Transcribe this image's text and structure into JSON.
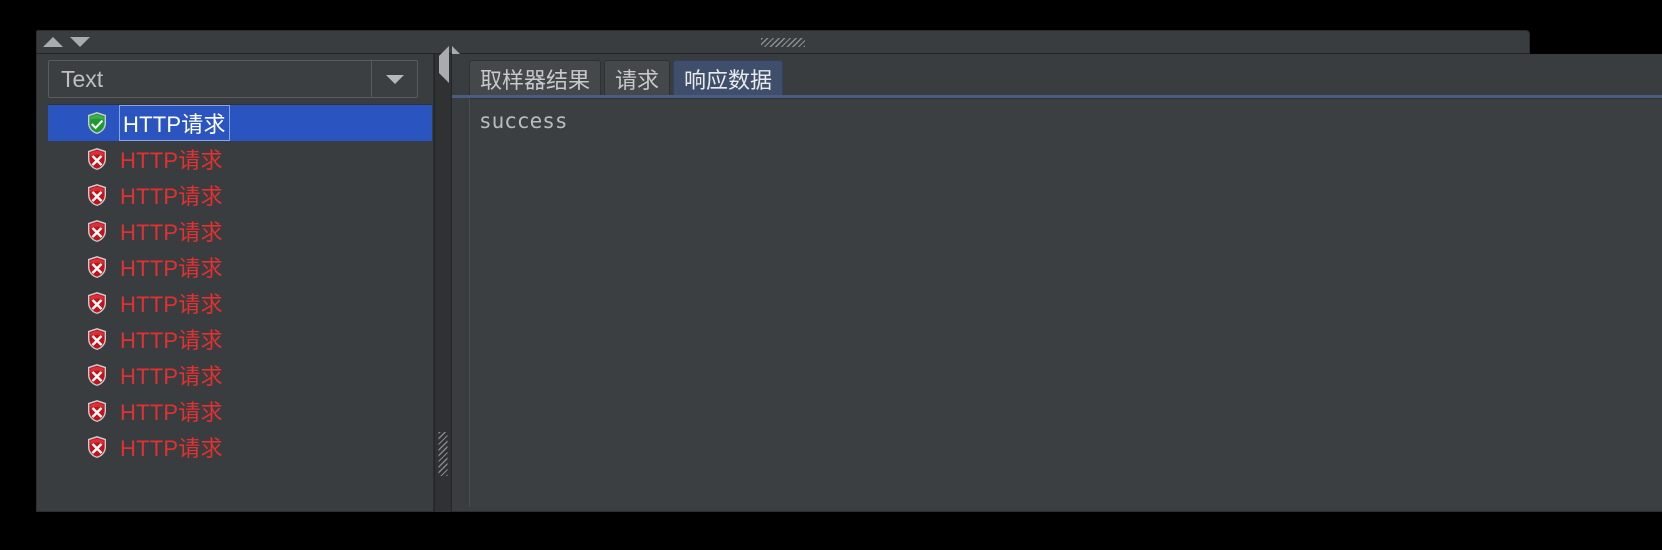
{
  "window": {
    "splitter_grip": "horizontal-splitter-grip",
    "collapse_up_label": "▲",
    "collapse_down_label": "▼"
  },
  "left_panel": {
    "view_selector": {
      "value": "Text",
      "placeholder": "Text",
      "caret_icon": "chevron-down-icon"
    },
    "results": [
      {
        "label": "HTTP请求",
        "status": "success",
        "selected": true
      },
      {
        "label": "HTTP请求",
        "status": "error",
        "selected": false
      },
      {
        "label": "HTTP请求",
        "status": "error",
        "selected": false
      },
      {
        "label": "HTTP请求",
        "status": "error",
        "selected": false
      },
      {
        "label": "HTTP请求",
        "status": "error",
        "selected": false
      },
      {
        "label": "HTTP请求",
        "status": "error",
        "selected": false
      },
      {
        "label": "HTTP请求",
        "status": "error",
        "selected": false
      },
      {
        "label": "HTTP请求",
        "status": "error",
        "selected": false
      },
      {
        "label": "HTTP请求",
        "status": "error",
        "selected": false
      },
      {
        "label": "HTTP请求",
        "status": "error",
        "selected": false
      }
    ]
  },
  "vertical_splitter": {
    "collapse_left_label": "◀",
    "collapse_right_label": "▶",
    "grip": "vertical-splitter-grip"
  },
  "right_panel": {
    "tabs": [
      {
        "label": "取样器结果",
        "active": false
      },
      {
        "label": "请求",
        "active": false
      },
      {
        "label": "响应数据",
        "active": true
      }
    ],
    "response_body": "success"
  },
  "colors": {
    "panel_background": "#3a3d3f",
    "selection_blue": "#2a55c0",
    "active_tab": "#3f4e6b",
    "error_red": "#e33030",
    "success_green": "#1f9a33",
    "text_gray": "#bdbfc1"
  }
}
